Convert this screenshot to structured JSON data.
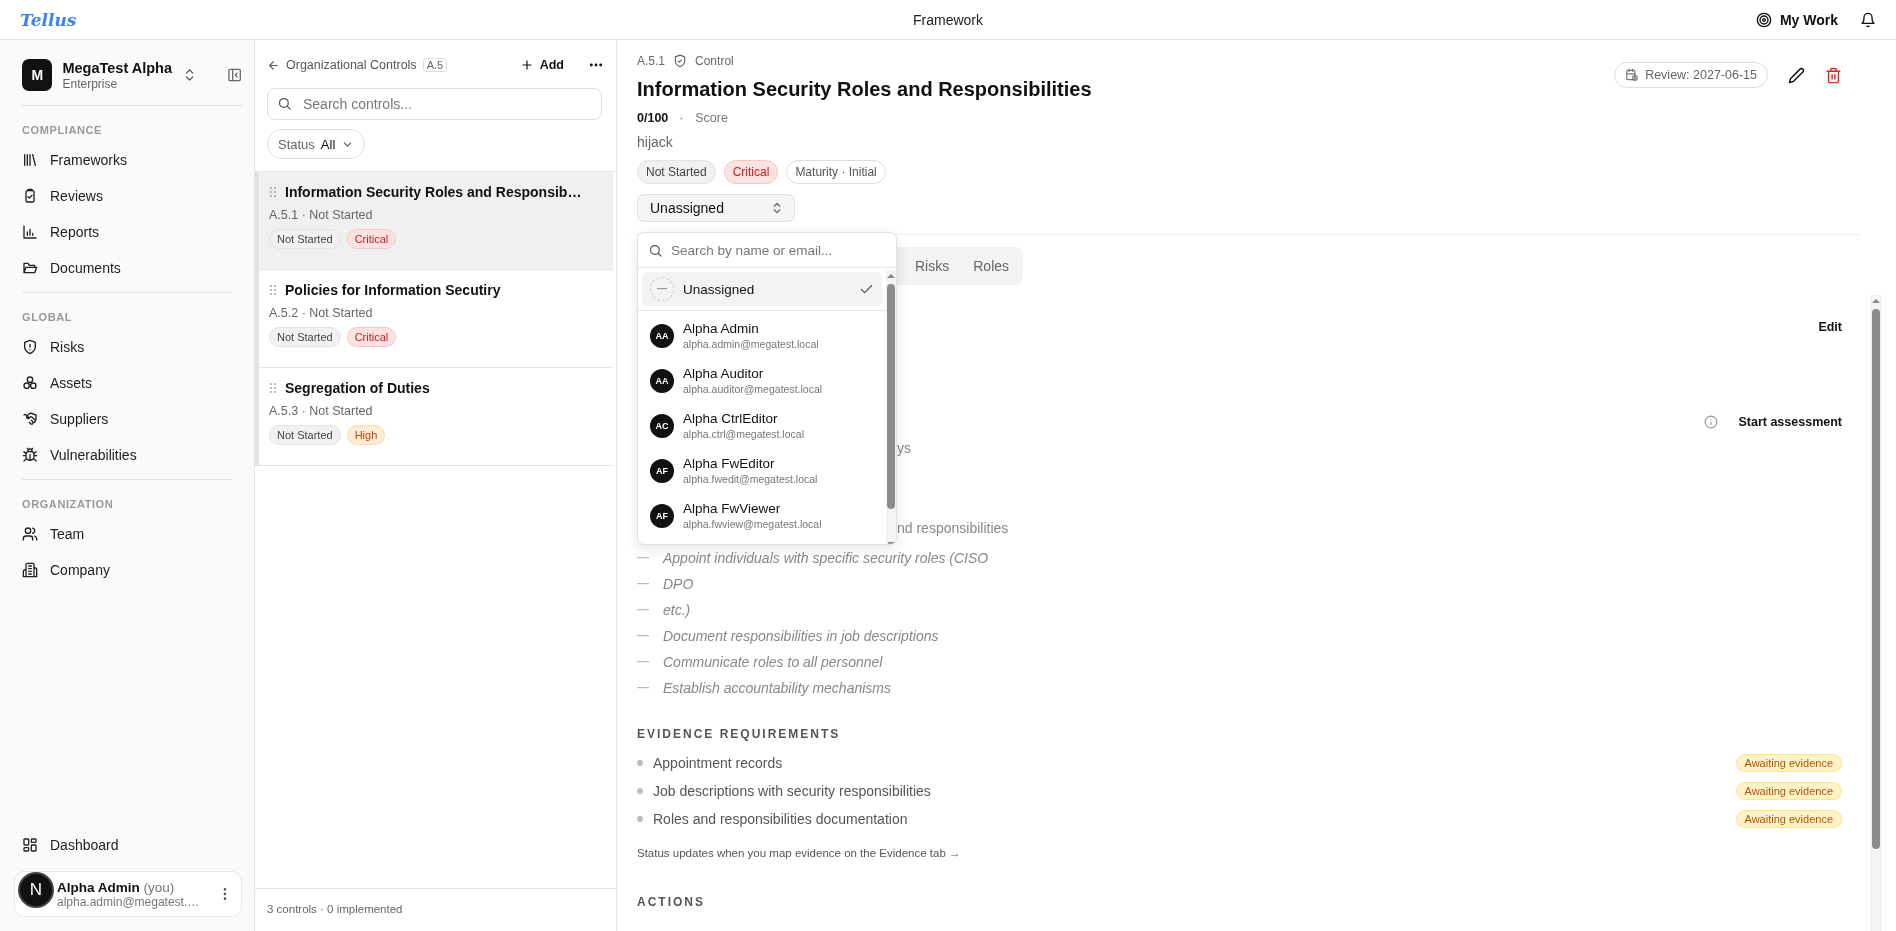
{
  "topbar": {
    "logo": "Tellus",
    "title": "Framework",
    "my_work": "My Work"
  },
  "sidebar": {
    "org": {
      "initial": "M",
      "name": "MegaTest Alpha",
      "plan": "Enterprise"
    },
    "sections": [
      {
        "label": "COMPLIANCE",
        "items": [
          {
            "label": "Frameworks",
            "selected": false
          },
          {
            "label": "Reviews",
            "selected": false
          },
          {
            "label": "Reports",
            "selected": false
          },
          {
            "label": "Documents",
            "selected": false
          }
        ]
      },
      {
        "label": "GLOBAL",
        "items": [
          {
            "label": "Risks",
            "selected": false
          },
          {
            "label": "Assets",
            "selected": false
          },
          {
            "label": "Suppliers",
            "selected": false
          },
          {
            "label": "Vulnerabilities",
            "selected": false
          }
        ]
      },
      {
        "label": "ORGANIZATION",
        "items": [
          {
            "label": "Team",
            "selected": false
          },
          {
            "label": "Company",
            "selected": false
          }
        ]
      }
    ],
    "bottom_items": [
      {
        "label": "Dashboard",
        "selected": false
      }
    ],
    "user": {
      "name": "Alpha Admin",
      "suffix": "(you)",
      "email": "alpha.admin@megatest.…"
    }
  },
  "dev_badge": "N",
  "list": {
    "back_label": "Organizational Controls",
    "code": "A.5",
    "add": "Add",
    "search_placeholder": "Search controls...",
    "filter": {
      "label": "Status",
      "value": "All"
    },
    "items": [
      {
        "title": "Information Security Roles and Responsib…",
        "meta": "A.5.1 · Not Started",
        "tags": [
          {
            "label": "Not Started",
            "kind": "status"
          },
          {
            "label": "Critical",
            "kind": "critical"
          }
        ],
        "selected": true
      },
      {
        "title": "Policies for Information Secutiry",
        "meta": "A.5.2 · Not Started",
        "tags": [
          {
            "label": "Not Started",
            "kind": "status"
          },
          {
            "label": "Critical",
            "kind": "critical"
          }
        ],
        "selected": false
      },
      {
        "title": "Segregation of Duties",
        "meta": "A.5.3 · Not Started",
        "tags": [
          {
            "label": "Not Started",
            "kind": "status"
          },
          {
            "label": "High",
            "kind": "high"
          }
        ],
        "selected": false
      }
    ],
    "footer": "3 controls · 0 implemented"
  },
  "detail": {
    "code": "A.5.1",
    "type": "Control",
    "title": "Information Security Roles and Responsibilities",
    "score": "0/100",
    "score_label": "Score",
    "description": "hijack",
    "tags": [
      {
        "label": "Not Started",
        "kind": "status"
      },
      {
        "label": "Critical",
        "kind": "critical"
      },
      {
        "label": "Maturity · Initial",
        "kind": "outline"
      }
    ],
    "assignee": "Unassigned",
    "review": "Review: 2027-06-15",
    "tabs": [
      {
        "label": "Risks",
        "selected": false
      },
      {
        "label": "Roles",
        "selected": false
      }
    ],
    "edit": "Edit",
    "start_assessment": "Start assessment",
    "fragments": [
      "ys",
      "nd responsibilities"
    ],
    "steps": [
      "Appoint individuals with specific security roles (CISO",
      "DPO",
      "etc.)",
      "Document responsibilities in job descriptions",
      "Communicate roles to all personnel",
      "Establish accountability mechanisms"
    ],
    "evidence": {
      "heading": "EVIDENCE REQUIREMENTS",
      "items": [
        {
          "label": "Appointment records",
          "status": "Awaiting evidence"
        },
        {
          "label": "Job descriptions with security responsibilities",
          "status": "Awaiting evidence"
        },
        {
          "label": "Roles and responsibilities documentation",
          "status": "Awaiting evidence"
        }
      ],
      "note": "Status updates when you map evidence on the Evidence tab →"
    },
    "actions_heading": "ACTIONS"
  },
  "dropdown": {
    "placeholder": "Search by name or email...",
    "options": [
      {
        "kind": "none",
        "name": "Unassigned",
        "selected": true
      },
      {
        "kind": "user",
        "initials": "AA",
        "name": "Alpha Admin",
        "email": "alpha.admin@megatest.local",
        "selected": false
      },
      {
        "kind": "user",
        "initials": "AA",
        "name": "Alpha Auditor",
        "email": "alpha.auditor@megatest.local",
        "selected": false
      },
      {
        "kind": "user",
        "initials": "AC",
        "name": "Alpha CtrlEditor",
        "email": "alpha.ctrl@megatest.local",
        "selected": false
      },
      {
        "kind": "user",
        "initials": "AF",
        "name": "Alpha FwEditor",
        "email": "alpha.fwedit@megatest.local",
        "selected": false
      },
      {
        "kind": "user",
        "initials": "AF",
        "name": "Alpha FwViewer",
        "email": "alpha.fwview@megatest.local",
        "selected": false
      }
    ]
  }
}
